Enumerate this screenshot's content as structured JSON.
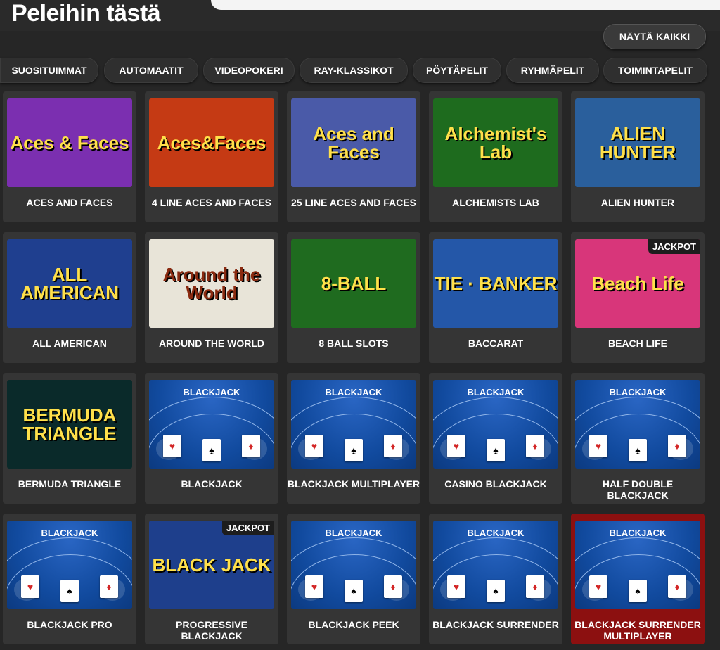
{
  "header": {
    "title": "Peleihin tästä",
    "show_all": "NÄYTÄ KAIKKI"
  },
  "filters": [
    "SUOSITUIMMAT",
    "AUTOMAATIT",
    "VIDEOPOKERI",
    "RAY-KLASSIKOT",
    "PÖYTÄPELIT",
    "RYHMÄPELIT",
    "TOIMINTAPELIT"
  ],
  "jackpot_label": "JACKPOT",
  "games": [
    {
      "title": "ACES AND FACES",
      "thumb_text": "Aces & Faces",
      "thumb_color": "#7b2fb0"
    },
    {
      "title": "4 LINE ACES AND FACES",
      "thumb_text": "Aces&Faces",
      "thumb_color": "#c53a14"
    },
    {
      "title": "25 LINE ACES AND FACES",
      "thumb_text": "Aces and Faces",
      "thumb_color": "#4a5aa8"
    },
    {
      "title": "ALCHEMISTS LAB",
      "thumb_text": "Alchemist's Lab",
      "thumb_color": "#1e6b1e"
    },
    {
      "title": "ALIEN HUNTER",
      "thumb_text": "ALIEN HUNTER",
      "thumb_color": "#2a5f9c"
    },
    {
      "title": "ALL AMERICAN",
      "thumb_text": "ALL AMERICAN",
      "thumb_color": "#1f3f8f"
    },
    {
      "title": "AROUND THE WORLD",
      "thumb_text": "Around the World",
      "thumb_color": "#e8e4d8"
    },
    {
      "title": "8 BALL SLOTS",
      "thumb_text": "8-BALL",
      "thumb_color": "#1f6b1f"
    },
    {
      "title": "BACCARAT",
      "thumb_text": "TIE · BANKER",
      "thumb_color": "#2457a8"
    },
    {
      "title": "BEACH LIFE",
      "thumb_text": "Beach Life",
      "thumb_color": "#d8367a",
      "jackpot": true
    },
    {
      "title": "BERMUDA TRIANGLE",
      "thumb_text": "BERMUDA TRIANGLE",
      "thumb_color": "#0a2a2a"
    },
    {
      "title": "BLACKJACK",
      "thumb_text": "BLACKJACK",
      "blackjack": true
    },
    {
      "title": "BLACKJACK MULTIPLAYER",
      "thumb_text": "BLACKJACK",
      "blackjack": true
    },
    {
      "title": "CASINO BLACKJACK",
      "thumb_text": "BLACKJACK",
      "blackjack": true
    },
    {
      "title": "HALF DOUBLE BLACKJACK",
      "thumb_text": "BLACKJACK",
      "blackjack": true
    },
    {
      "title": "BLACKJACK PRO",
      "thumb_text": "BLACKJACK",
      "blackjack": true
    },
    {
      "title": "PROGRESSIVE BLACKJACK",
      "thumb_text": "BLACK JACK",
      "thumb_color": "#1e3f8c",
      "jackpot": true
    },
    {
      "title": "BLACKJACK PEEK",
      "thumb_text": "BLACKJACK",
      "blackjack": true
    },
    {
      "title": "BLACKJACK SURRENDER",
      "thumb_text": "BLACKJACK",
      "blackjack": true
    },
    {
      "title": "BLACKJACK SURRENDER MULTIPLAYER",
      "thumb_text": "BLACKJACK",
      "blackjack": true,
      "active": true
    }
  ]
}
